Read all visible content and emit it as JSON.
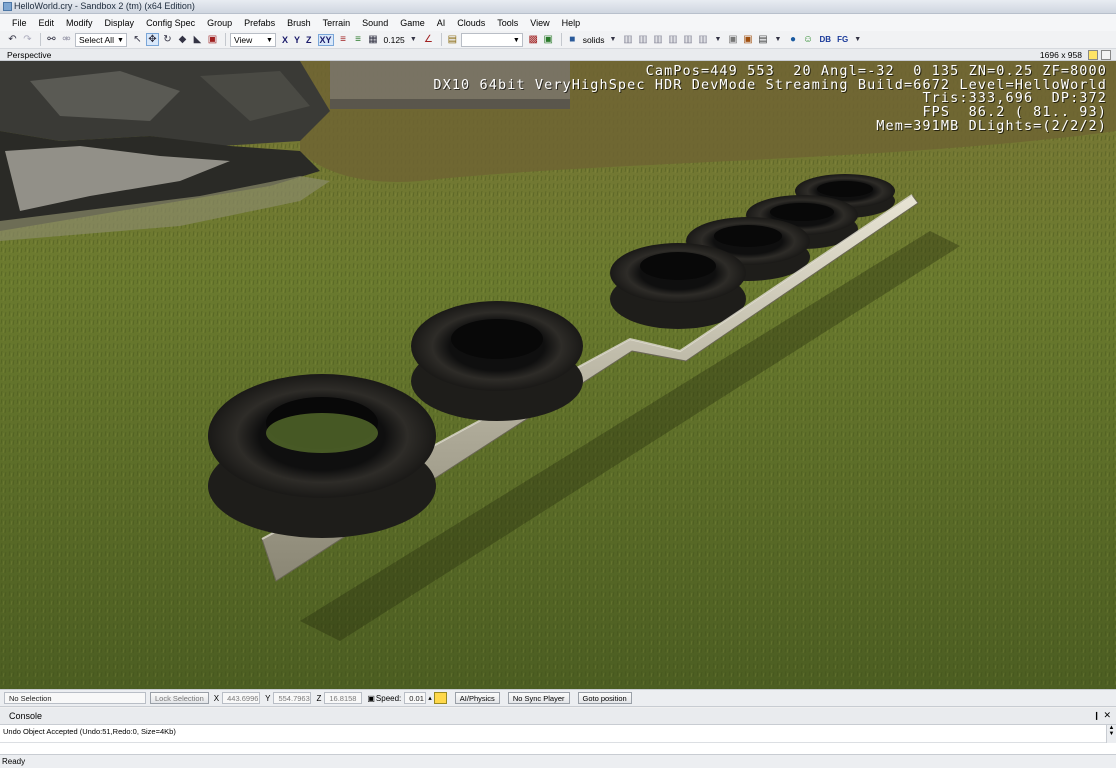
{
  "window": {
    "title": "HelloWorld.cry - Sandbox 2 (tm) (x64 Edition)"
  },
  "menu": [
    "File",
    "Edit",
    "Modify",
    "Display",
    "Config Spec",
    "Group",
    "Prefabs",
    "Brush",
    "Terrain",
    "Sound",
    "Game",
    "AI",
    "Clouds",
    "Tools",
    "View",
    "Help"
  ],
  "toolbar": {
    "selection_combo": "Select All",
    "coord_combo": "View",
    "axis_x": "X",
    "axis_y": "Y",
    "axis_z": "Z",
    "axis_xy": "XY",
    "grid_value": "0.125",
    "render_mode": "solids",
    "db_label": "DB",
    "fg_label": "FG"
  },
  "viewport": {
    "label": "Perspective",
    "resolution": "1696 x 958",
    "hud": [
      "CamPos=449 553  20 Angl=-32  0 135 ZN=0.25 ZF=8000",
      "DX10 64bit VeryHighSpec HDR DevMode Streaming Build=6672 Level=HelloWorld",
      "Tris:333,696  DP:372",
      "FPS  86.2 ( 81.. 93)",
      "Mem=391MB DLights=(2/2/2)"
    ]
  },
  "navbar": {
    "selection": "No Selection",
    "lock_selection": "Lock Selection",
    "x_label": "X",
    "x_value": "443.6996",
    "y_label": "Y",
    "y_value": "554.7963",
    "z_label": "Z",
    "z_value": "16.8158",
    "speed_label": "Speed:",
    "speed_value": "0.01",
    "ai_physics": "AI/Physics",
    "no_sync": "No Sync Player",
    "goto": "Goto position"
  },
  "console": {
    "title": "Console",
    "lines": [
      "Undo Object Accepted (Undo:51,Redo:0, Size=4Kb)"
    ]
  },
  "status": {
    "text": "Ready"
  },
  "colors": {
    "accent": "#3a6ea5",
    "grass": "#5c6a2a",
    "hud_text": "#ffffff"
  }
}
